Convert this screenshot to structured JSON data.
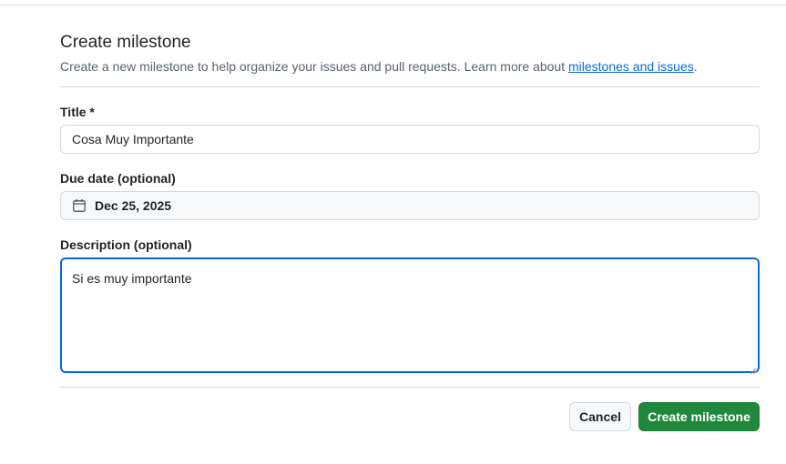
{
  "header": {
    "title": "Create milestone",
    "subtitle_text": "Create a new milestone to help organize your issues and pull requests. Learn more about ",
    "subtitle_link": "milestones and issues",
    "subtitle_end": "."
  },
  "form": {
    "title_label": "Title *",
    "title_value": "Cosa Muy Importante",
    "due_label": "Due date (optional)",
    "due_value": "Dec 25, 2025",
    "due_icon": "calendar-icon",
    "description_label": "Description (optional)",
    "description_value": "Si es muy importante"
  },
  "actions": {
    "cancel_label": "Cancel",
    "create_label": "Create milestone"
  },
  "colors": {
    "primary_button": "#1f883d",
    "focus_border": "#0969da",
    "link": "#0969da"
  }
}
